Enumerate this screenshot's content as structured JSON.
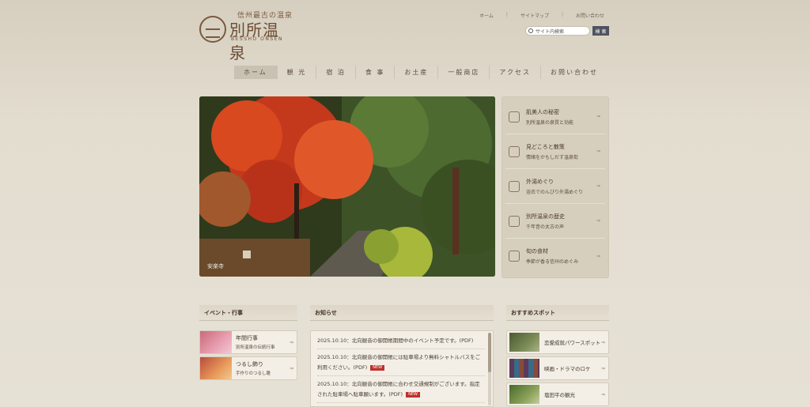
{
  "header": {
    "logo_small": "信州最古の温泉",
    "logo_main": "別所温泉",
    "logo_roman": "BESSHO ONSEN",
    "top_links": [
      "ホーム",
      "サイトマップ",
      "お問い合わせ"
    ],
    "top_link_sep": "|",
    "search_placeholder": "サイト内検索",
    "search_button": "検 索"
  },
  "nav": [
    "ホーム",
    "観 光",
    "宿 泊",
    "食 事",
    "お土産",
    "一般商店",
    "アクセス",
    "お問い合わせ"
  ],
  "hero": {
    "caption": "安楽寺"
  },
  "side": [
    {
      "title": "肌美人の秘密",
      "sub": "別所温泉の泉質と効能"
    },
    {
      "title": "見どころと散策",
      "sub": "情緒をかもしだす温泉街"
    },
    {
      "title": "外湯めぐり",
      "sub": "浴衣でのんびり外湯めぐり"
    },
    {
      "title": "別所温泉の歴史",
      "sub": "千年昔の太古の声"
    },
    {
      "title": "旬の食材",
      "sub": "季節が香る信州のめぐみ"
    }
  ],
  "side_arrow": "⇒",
  "events": {
    "heading": "イベント・行事",
    "items": [
      {
        "title": "年間行事",
        "sub": "別所温泉の伝統行事"
      },
      {
        "title": "つるし飾り",
        "sub": "手作りのつるし雛"
      }
    ]
  },
  "news": {
    "heading": "お知らせ",
    "new_label": "NEW",
    "items": [
      "2025.10.10：北向観音の御開帳期間中のイベント予定です。(PDF)",
      "2025.10.10：北向観音の御開帳には駐車場より無料シャトルバスをご利用ください。(PDF)",
      "2025.10.10：北向観音の御開帳に合わせ交通規制がございます。指定された駐車場へ駐車願います。(PDF)"
    ]
  },
  "spots": {
    "heading": "おすすめスポット",
    "items": [
      {
        "title": "恋愛成就パワースポット"
      },
      {
        "title": "映画・ドラマのロケ"
      },
      {
        "title": "塩田平の観光"
      }
    ]
  },
  "colors": {
    "accent_nav_active": "#c9c1b1",
    "search_button": "#4e5160",
    "new_badge": "#c0302a"
  }
}
